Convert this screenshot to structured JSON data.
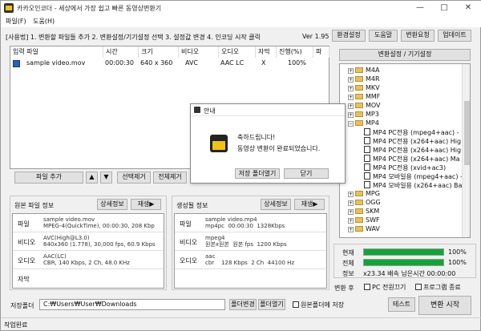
{
  "window": {
    "title": "카카오인코더 - 세상에서 가장 쉽고 빠른 동영상변환기",
    "min": "—",
    "max": "□",
    "close": "✕"
  },
  "menu": [
    "파일(F)",
    "도움(H)"
  ],
  "toolbar": {
    "guide": "[사용법] 1. 변환할 파일들 추가   2. 변환설정/기기설정 선택   3. 설정값 변경   4. 인코딩 시작 클릭",
    "version": "Ver 1.95",
    "env_settings": "환경설정",
    "help": "도움말",
    "request": "변환요청",
    "update": "업데이트"
  },
  "file_table": {
    "columns": [
      "입력 파일",
      "시간",
      "크기",
      "비디오",
      "오디오",
      "자막",
      "진행(%)",
      "파"
    ],
    "rows": [
      {
        "name": "sample video.mov",
        "time": "00:00:30",
        "size": "640 x 360",
        "video": "AVC",
        "audio": "AAC LC",
        "sub": "X",
        "progress": "100%",
        "extra": ""
      }
    ]
  },
  "file_buttons": {
    "add": "파일 추가",
    "up": "▲",
    "down": "▼",
    "remove": "선택제거",
    "remove_all": "전체제거"
  },
  "source_info": {
    "title": "원본 파일 정보",
    "detail": "상세정보",
    "play": "재생▶",
    "rows": [
      {
        "key": "파일",
        "val": "sample video.mov\nMPEG-4(QuickTime), 00:00:30, 208 Kbp"
      },
      {
        "key": "비디오",
        "val": "AVC(High@L3.0)\n640x360 (1.778), 30,000 fps, 60.9 Kbps"
      },
      {
        "key": "오디오",
        "val": "AAC(LC)\nCBR, 140 Kbps, 2 Ch, 48.0 KHz"
      },
      {
        "key": "자막",
        "val": ""
      }
    ]
  },
  "output_info": {
    "title": "생성될 정보",
    "detail": "상세정보",
    "play": "재생▶",
    "rows": [
      {
        "key": "파일",
        "val": "sample video.mp4\nmp4pc  00:00:30  1328Kbps"
      },
      {
        "key": "비디오",
        "val": "mpeg4\n원본x원본  원본 fps  1200 Kbps"
      },
      {
        "key": "오디오",
        "val": "aac\ncbr    128 Kbps  2 Ch  44100 Hz"
      }
    ]
  },
  "tree": {
    "header": "변환설정 / 기기설정",
    "items": [
      {
        "label": "M4A",
        "type": "folder",
        "indent": 0
      },
      {
        "label": "M4R",
        "type": "folder",
        "indent": 0
      },
      {
        "label": "MKV",
        "type": "folder",
        "indent": 0
      },
      {
        "label": "MMF",
        "type": "folder",
        "indent": 0
      },
      {
        "label": "MOV",
        "type": "folder",
        "indent": 0
      },
      {
        "label": "MP3",
        "type": "folder",
        "indent": 0
      },
      {
        "label": "MP4",
        "type": "folder-open",
        "indent": 0
      },
      {
        "label": "MP4 PC전용 (mpeg4+aac) - ",
        "type": "doc",
        "indent": 1
      },
      {
        "label": "MP4 PC전용 (x264+aac) Hig",
        "type": "doc",
        "indent": 1
      },
      {
        "label": "MP4 PC전용 (x264+aac) Hig",
        "type": "doc",
        "indent": 1
      },
      {
        "label": "MP4 PC전용 (x264+aac) Ma",
        "type": "doc",
        "indent": 1
      },
      {
        "label": "MP4 PC전용 (xvid+ac3)",
        "type": "doc",
        "indent": 1
      },
      {
        "label": "MP4 모바일용 (mpeg4+aac) -",
        "type": "doc",
        "indent": 1
      },
      {
        "label": "MP4 모바일용 (x264+aac) Ba",
        "type": "doc",
        "indent": 1
      },
      {
        "label": "MPG",
        "type": "folder",
        "indent": 0
      },
      {
        "label": "OGG",
        "type": "folder",
        "indent": 0
      },
      {
        "label": "SKM",
        "type": "folder",
        "indent": 0
      },
      {
        "label": "SWF",
        "type": "folder",
        "indent": 0
      },
      {
        "label": "WAV",
        "type": "folder",
        "indent": 0
      }
    ]
  },
  "progress": {
    "current_label": "현재",
    "current_value": 1.0,
    "current_text": "100%",
    "total_label": "전체",
    "total_value": 1.0,
    "total_text": "100%",
    "info_label": "정보",
    "info_text": "x23.34 배속    남은시간  00:00:00"
  },
  "after": {
    "label": "변환 후",
    "pc_off": "PC 전원끄기",
    "exit": "프로그램 종료"
  },
  "save": {
    "label": "저장폴더",
    "path": "C:₩Users₩User₩Downloads",
    "change": "폴더변경",
    "open": "폴더열기",
    "same_folder": "원본폴더에 저장"
  },
  "actions": {
    "test": "테스트",
    "start": "변환 시작"
  },
  "status": "작업완료",
  "dialog": {
    "title": "안내",
    "message1": "축하드립니다!",
    "message2": "동영상 변환이 완료되었습니다.",
    "open_folder": "저장 폴더열기",
    "close": "닫기"
  },
  "colors": {
    "progress": "#0ea735",
    "accent": "#f1c40f"
  }
}
